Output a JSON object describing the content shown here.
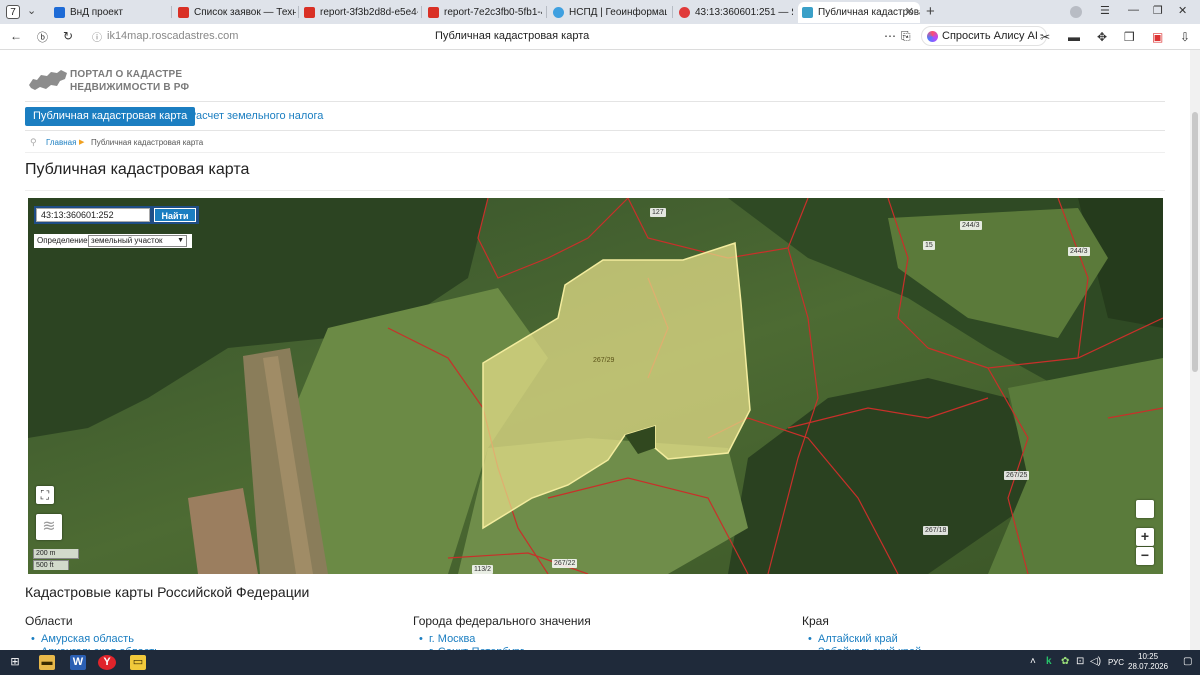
{
  "browser": {
    "tab_count": "7",
    "tabs": [
      {
        "label": "ВнД проект",
        "color": "#1e6bd6"
      },
      {
        "label": "Список заявок — ТехноКа",
        "color": "#d93025"
      },
      {
        "label": "report-3f3b2d8d-e5e4-4a",
        "color": "#d93025"
      },
      {
        "label": "report-7e2c3fb0-5fb1-421",
        "color": "#d93025"
      },
      {
        "label": "НСПД | Геоинформацио",
        "color": "#3fa0e0"
      },
      {
        "label": "43:13:360601:251 — Яндекс",
        "color": "#e03a3a"
      },
      {
        "label": "Публичная кадастрова",
        "color": "#3aa0c8"
      }
    ],
    "url": "ik14map.roscadastres.com",
    "page_title": "Публичная кадастровая карта",
    "alice_label": "Спросить Алису AI"
  },
  "site": {
    "logo_line1": "ПОРТАЛ О КАДАСТРЕ",
    "logo_line2": "НЕДВИЖИМОСТИ В РФ",
    "nav_active": "Публичная кадастровая карта",
    "nav_link": "Расчет земельного налога",
    "breadcrumb_home": "Главная",
    "breadcrumb_current": "Публичная кадастровая карта",
    "heading": "Публичная кадастровая карта"
  },
  "map": {
    "search_value": "43:13:360601:252",
    "search_button": "Найти",
    "definition_label": "Определение:",
    "definition_value": "земельный участок",
    "scale_m": "200 m",
    "scale_ft": "500 ft",
    "zoom_in": "+",
    "zoom_out": "−",
    "plot_labels": [
      "127",
      "244/3",
      "15",
      "244/3",
      "267/29",
      "267/25",
      "267/18",
      "267/22",
      "113/2"
    ],
    "highlight_color": "#e8e08a",
    "boundary_color": "#c8302a"
  },
  "sections": {
    "heading": "Кадастровые карты Российской Федерации",
    "col1_title": "Области",
    "col1_items": [
      "Амурская область",
      "Архангельская область"
    ],
    "col2_title": "Города федерального значения",
    "col2_items": [
      "г. Москва",
      "г. Санкт-Петербург"
    ],
    "col3_title": "Края",
    "col3_items": [
      "Алтайский край",
      "Забайкальский край"
    ]
  },
  "taskbar": {
    "time": "10:25",
    "date": "28.07.2026",
    "lang": "РУС"
  }
}
